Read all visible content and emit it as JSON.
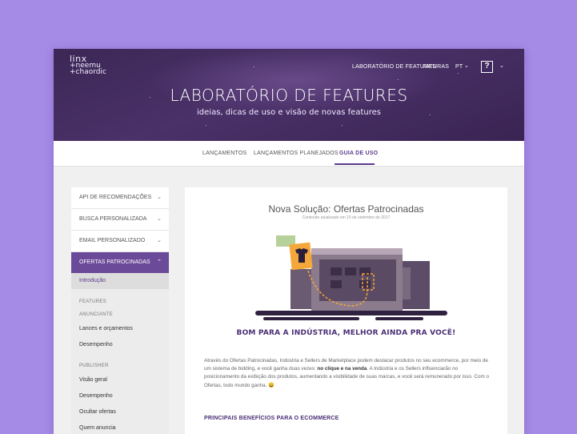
{
  "logo": {
    "line1": "linx",
    "line2": "+neemu",
    "line3": "+chaordic"
  },
  "nav": {
    "lab": "LABORATÓRIO DE FEATURES",
    "faturas": "FATURAS",
    "lang": "PT",
    "help_icon": "?",
    "chevron": "⌄"
  },
  "hero": {
    "title": "LABORATÓRIO DE FEATURES",
    "subtitle": "ideias, dicas de uso e visão de novas features"
  },
  "tabs": [
    "LANÇAMENTOS",
    "LANÇAMENTOS PLANEJADOS",
    "GUIA DE USO"
  ],
  "sidebar": {
    "items": [
      {
        "label": "API DE RECOMENDAÇÕES"
      },
      {
        "label": "BUSCA PERSONALIZADA"
      },
      {
        "label": "EMAIL PERSONALIZADO"
      },
      {
        "label": "OFERTAS PATROCINADAS"
      }
    ],
    "chevron": "⌄",
    "intro": "Introdução",
    "features_head": "FEATURES",
    "anunciante_head": "ANUNCIANTE",
    "anunciante_links": [
      "Lances e orçamentos",
      "Desempenho"
    ],
    "publisher_head": "PUBLISHER",
    "publisher_links": [
      "Visão geral",
      "Desempenho",
      "Ocultar ofertas",
      "Quem anuncia"
    ]
  },
  "content": {
    "title": "Nova Solução: Ofertas Patrocinadas",
    "date": "Conteúdo atualizado em 15 de setembro de 2017",
    "slogan": "BOM PARA A INDÚSTRIA, MELHOR AINDA PRA VOCÊ!",
    "para_a": "Através do Ofertas Patrocinadas, Indústria e Sellers de Marketplace podem destacar produtos no seu ecommerce, por meio de um sistema de bidding, e você ganha duas vezes: ",
    "para_b": "no clique e na venda",
    "para_c": ". A Indústria e os Sellers influenciarão no posicionamento da exibição dos produtos, aumentando a visibilidade de suas marcas, e você será remunerado por isso. Com o Ofertas, todo mundo ganha. 😀",
    "section_heading": "PRINCIPAIS BENEFÍCIOS PARA O ECOMMERCE"
  },
  "colors": {
    "background": "#a58ae6",
    "hero": "#3f2a5a",
    "accent": "#6c4a9a",
    "dark_accent": "#4a2e75"
  }
}
